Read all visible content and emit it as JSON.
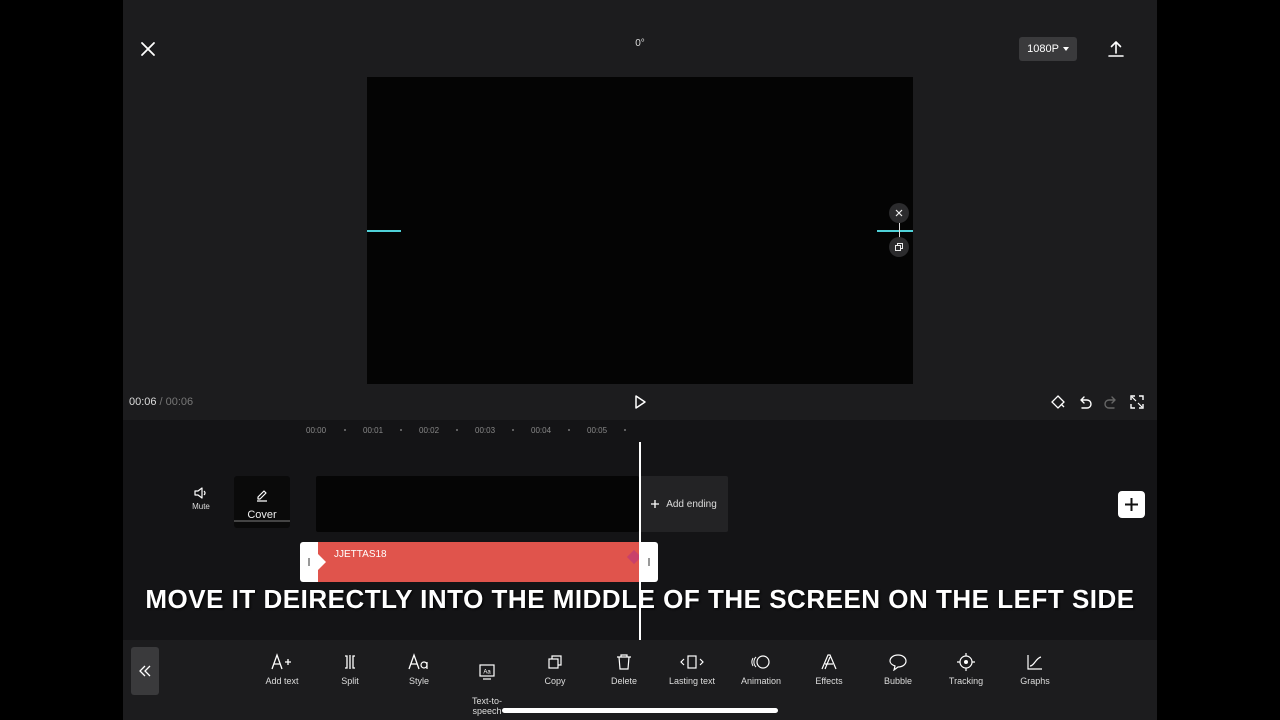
{
  "header": {
    "rotation": "0°",
    "resolution": "1080P"
  },
  "player": {
    "current_time": "00:06",
    "separator": "/",
    "total_time": "00:06"
  },
  "timeline": {
    "ruler": [
      "00:00",
      "00:01",
      "00:02",
      "00:03",
      "00:04",
      "00:05"
    ],
    "mute_label": "Mute",
    "cover_label": "Cover",
    "add_ending_label": "Add ending",
    "text_clip_label": "JJETTAS18"
  },
  "caption": "MOVE IT DEIRECTLY INTO THE MIDDLE OF THE SCREEN ON THE LEFT SIDE",
  "toolbar": {
    "items": [
      {
        "label": "Add text",
        "icon": "add-text-icon"
      },
      {
        "label": "Split",
        "icon": "split-icon"
      },
      {
        "label": "Style",
        "icon": "style-icon"
      },
      {
        "label": "Text-to-\nspeech",
        "icon": "text-to-speech-icon"
      },
      {
        "label": "Copy",
        "icon": "copy-icon"
      },
      {
        "label": "Delete",
        "icon": "delete-icon"
      },
      {
        "label": "Lasting text",
        "icon": "lasting-text-icon"
      },
      {
        "label": "Animation",
        "icon": "animation-icon"
      },
      {
        "label": "Effects",
        "icon": "effects-icon"
      },
      {
        "label": "Bubble",
        "icon": "bubble-icon"
      },
      {
        "label": "Tracking",
        "icon": "tracking-icon"
      },
      {
        "label": "Graphs",
        "icon": "graphs-icon"
      }
    ]
  },
  "colors": {
    "background": "#1c1c1e",
    "text_clip": "#e0544c",
    "guide": "#4fd1d8"
  }
}
